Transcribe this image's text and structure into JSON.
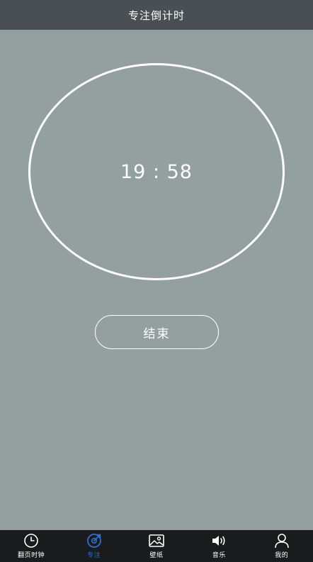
{
  "header": {
    "title": "专注倒计时"
  },
  "timer": {
    "display": "19 : 58"
  },
  "actions": {
    "end_label": "结束"
  },
  "tabs": [
    {
      "label": "翻页时钟",
      "icon": "clock-icon",
      "active": false
    },
    {
      "label": "专注",
      "icon": "focus-target-icon",
      "active": true
    },
    {
      "label": "壁纸",
      "icon": "image-icon",
      "active": false
    },
    {
      "label": "音乐",
      "icon": "speaker-icon",
      "active": false
    },
    {
      "label": "我的",
      "icon": "user-icon",
      "active": false
    }
  ],
  "colors": {
    "background": "#93a09f",
    "header": "#4a4f53",
    "tab_bar": "#191b1d",
    "active_tab": "#2f6fd6",
    "foreground": "#ffffff"
  }
}
